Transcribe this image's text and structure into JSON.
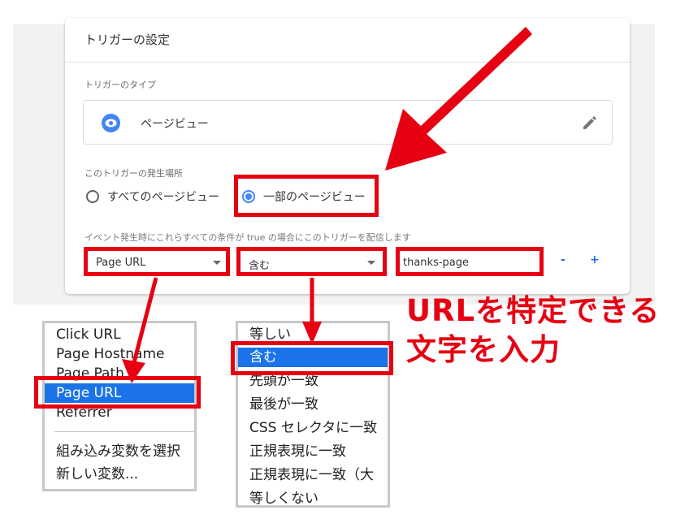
{
  "card": {
    "title": "トリガーの設定",
    "type_label": "トリガーのタイプ",
    "type_name": "ページビュー",
    "fires_on_label": "このトリガーの発生場所",
    "radio_all": "すべてのページビュー",
    "radio_some": "一部のページビュー",
    "condition_label": "イベント発生時にこれらすべての条件が true の場合にこのトリガーを配信します",
    "variable_value": "Page URL",
    "operator_value": "含む",
    "text_value": "thanks-page",
    "minus_label": "-",
    "plus_label": "+"
  },
  "variable_dropdown": {
    "items": [
      "Click URL",
      "Page Hostname",
      "Page Path",
      "Page URL",
      "Referrer",
      "組み込み変数を選択",
      "新しい変数..."
    ],
    "selected": "Page URL"
  },
  "operator_dropdown": {
    "items": [
      "等しい",
      "含む",
      "先頭が一致",
      "最後が一致",
      "CSS セレクタに一致",
      "正規表現に一致",
      "正規表現に一致（大",
      "等しくない"
    ],
    "selected": "含む"
  },
  "callout": {
    "line1": "URLを特定できる",
    "line2": "文字を入力"
  },
  "colors": {
    "highlight_red": "#e60012",
    "accent_blue": "#4285f4",
    "selected_blue": "#1a73e8"
  }
}
